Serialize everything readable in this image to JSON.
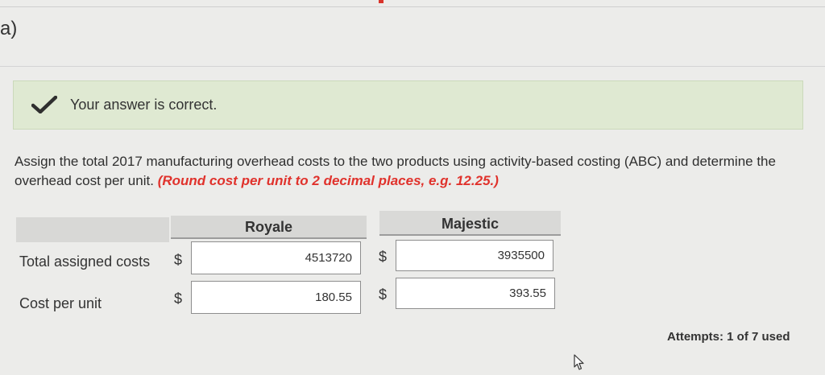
{
  "part": {
    "label": "a)"
  },
  "banner": {
    "message": "Your answer is correct.",
    "icon": "checkmark-icon",
    "background": "#dfe9d2"
  },
  "question": {
    "text": "Assign the total 2017 manufacturing overhead costs to the two products using activity-based costing (ABC) and determine the overhead cost per unit.",
    "hint": "(Round cost per unit to 2 decimal places, e.g. 12.25.)",
    "hint_color": "#e0322c"
  },
  "table": {
    "columns": [
      "Royale",
      "Majestic"
    ],
    "rows": [
      {
        "label": "Total assigned costs",
        "currency": "$",
        "royale": "4513720",
        "majestic": "3935500"
      },
      {
        "label": "Cost per unit",
        "currency": "$",
        "royale": "180.55",
        "majestic": "393.55"
      }
    ]
  },
  "attempts": {
    "text": "Attempts: 1 of 7 used"
  }
}
